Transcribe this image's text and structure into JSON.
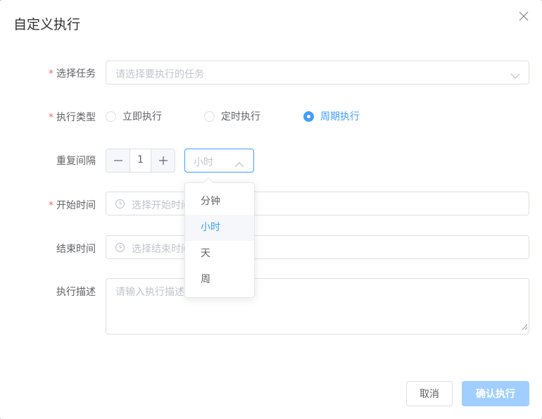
{
  "dialog": {
    "title": "自定义执行",
    "close_icon": "close-icon"
  },
  "form": {
    "task": {
      "label": "选择任务",
      "required": true,
      "placeholder": "请选择要执行的任务"
    },
    "exec_type": {
      "label": "执行类型",
      "required": true,
      "options": [
        "立即执行",
        "定时执行",
        "周期执行"
      ],
      "selected": "周期执行"
    },
    "repeat": {
      "label": "重复间隔",
      "value": "1",
      "unit_placeholder": "小时",
      "unit_options": [
        "分钟",
        "小时",
        "天",
        "周"
      ],
      "hovered_option": "小时"
    },
    "start_time": {
      "label": "开始时间",
      "required": true,
      "placeholder": "选择开始时间"
    },
    "end_time": {
      "label": "结束时间",
      "placeholder": "选择结束时间"
    },
    "description": {
      "label": "执行描述",
      "placeholder": "请输入执行描述"
    }
  },
  "footer": {
    "cancel_label": "取消",
    "confirm_label": "确认执行"
  },
  "colors": {
    "primary": "#409eff",
    "primary_disabled": "#a0cfff",
    "required": "#f56c6c",
    "placeholder": "#c0c4cc",
    "border": "#dcdfe6"
  }
}
